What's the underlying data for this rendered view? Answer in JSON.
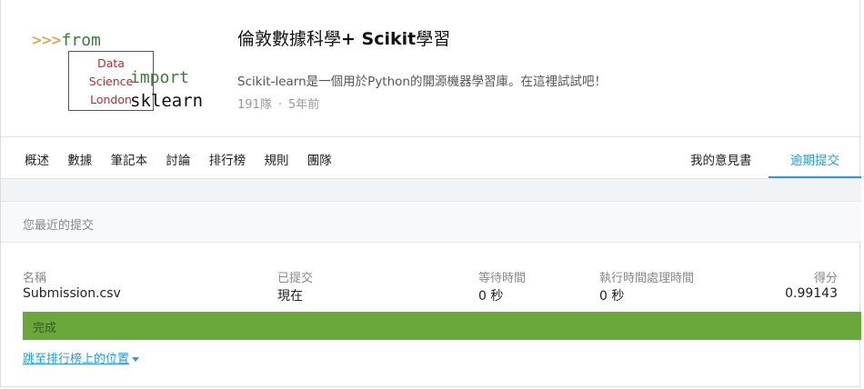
{
  "logo": {
    "arrows": ">>>",
    "from": "from",
    "box_lines": [
      "Data",
      "Science",
      "London"
    ],
    "import": "import",
    "sklearn": "sklearn"
  },
  "competition": {
    "title_prefix": "倫敦數據科學",
    "title_bold": "+ Scikit",
    "title_suffix": "學習",
    "subtitle": "Scikit-learn是一個用於Python的開源機器學習庫。在這裡試試吧！",
    "teams": "191隊",
    "separator": "·",
    "age": "5年前"
  },
  "tabs": [
    "概述",
    "數據",
    "筆記本",
    "討論",
    "排行榜",
    "規則",
    "團隊"
  ],
  "tabs_right": {
    "my_feedback": "我的意見書",
    "late_submission": "逾期提交"
  },
  "section": {
    "title": "您最近的提交"
  },
  "submission": {
    "headers": {
      "name": "名稱",
      "submitted": "已提交",
      "wait_time": "等待時間",
      "exec_time": "執行時間處理時間",
      "score": "得分"
    },
    "values": {
      "name": "Submission.csv",
      "submitted": "現在",
      "wait_time": "0 秒",
      "exec_time": "0 秒",
      "score": "0.99143"
    },
    "status": "完成",
    "status_color": "#6aa83c",
    "jump_link": "跳至排行榜上的位置"
  },
  "colors": {
    "accent": "#2a9bd3",
    "logo_green": "#3a7a3a",
    "logo_orange": "#e39a2b",
    "logo_red": "#c0282d"
  }
}
